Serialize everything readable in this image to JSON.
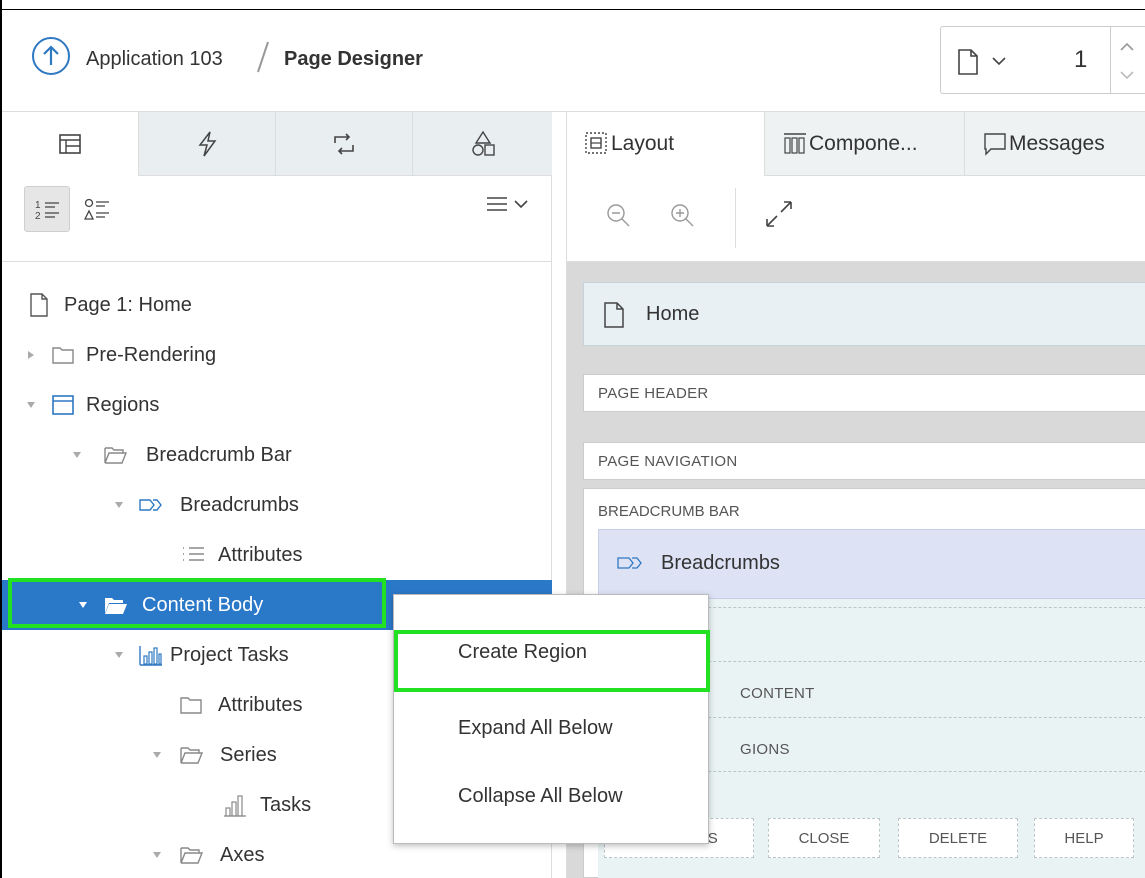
{
  "header": {
    "app_label": "Application 103",
    "page_title": "Page Designer",
    "page_number": "1"
  },
  "left_panel": {
    "tabs": [
      {
        "icon": "rendering-tree-icon"
      },
      {
        "icon": "dynamic-actions-icon"
      },
      {
        "icon": "processing-icon"
      },
      {
        "icon": "shared-components-icon"
      }
    ],
    "tree": [
      {
        "label": "Page 1: Home",
        "icon": "page-icon"
      },
      {
        "label": "Pre-Rendering",
        "icon": "folder-icon"
      },
      {
        "label": "Regions",
        "icon": "regions-icon"
      },
      {
        "label": "Breadcrumb Bar",
        "icon": "folder-open-icon"
      },
      {
        "label": "Breadcrumbs",
        "icon": "breadcrumb-icon"
      },
      {
        "label": "Attributes",
        "icon": "attributes-icon"
      },
      {
        "label": "Content Body",
        "icon": "folder-open-icon"
      },
      {
        "label": "Project Tasks",
        "icon": "chart-icon"
      },
      {
        "label": "Attributes",
        "icon": "folder-icon"
      },
      {
        "label": "Series",
        "icon": "folder-open-icon"
      },
      {
        "label": "Tasks",
        "icon": "chart-small-icon"
      },
      {
        "label": "Axes",
        "icon": "folder-open-icon"
      }
    ]
  },
  "right_panel": {
    "tabs": [
      {
        "label": "Layout",
        "icon": "layout-icon"
      },
      {
        "label": "Compone...",
        "icon": "components-icon"
      },
      {
        "label": "Messages",
        "icon": "messages-icon"
      }
    ],
    "canvas": {
      "page_name": "Home",
      "page_header": "PAGE HEADER",
      "page_navigation": "PAGE NAVIGATION",
      "breadcrumb_bar": "BREADCRUMB BAR",
      "breadcrumbs_region": "Breadcrumbs",
      "content_label": "CONTENT",
      "regions_label": "GIONS",
      "button_slots": [
        "PREVIOUS",
        "CLOSE",
        "DELETE",
        "HELP"
      ]
    }
  },
  "context_menu": {
    "items": [
      "Create Region",
      "Expand All Below",
      "Collapse All Below"
    ]
  },
  "colors": {
    "selected_row": "#2a78c8",
    "highlight_outline": "#22e022",
    "accent": "#2f78c2"
  }
}
